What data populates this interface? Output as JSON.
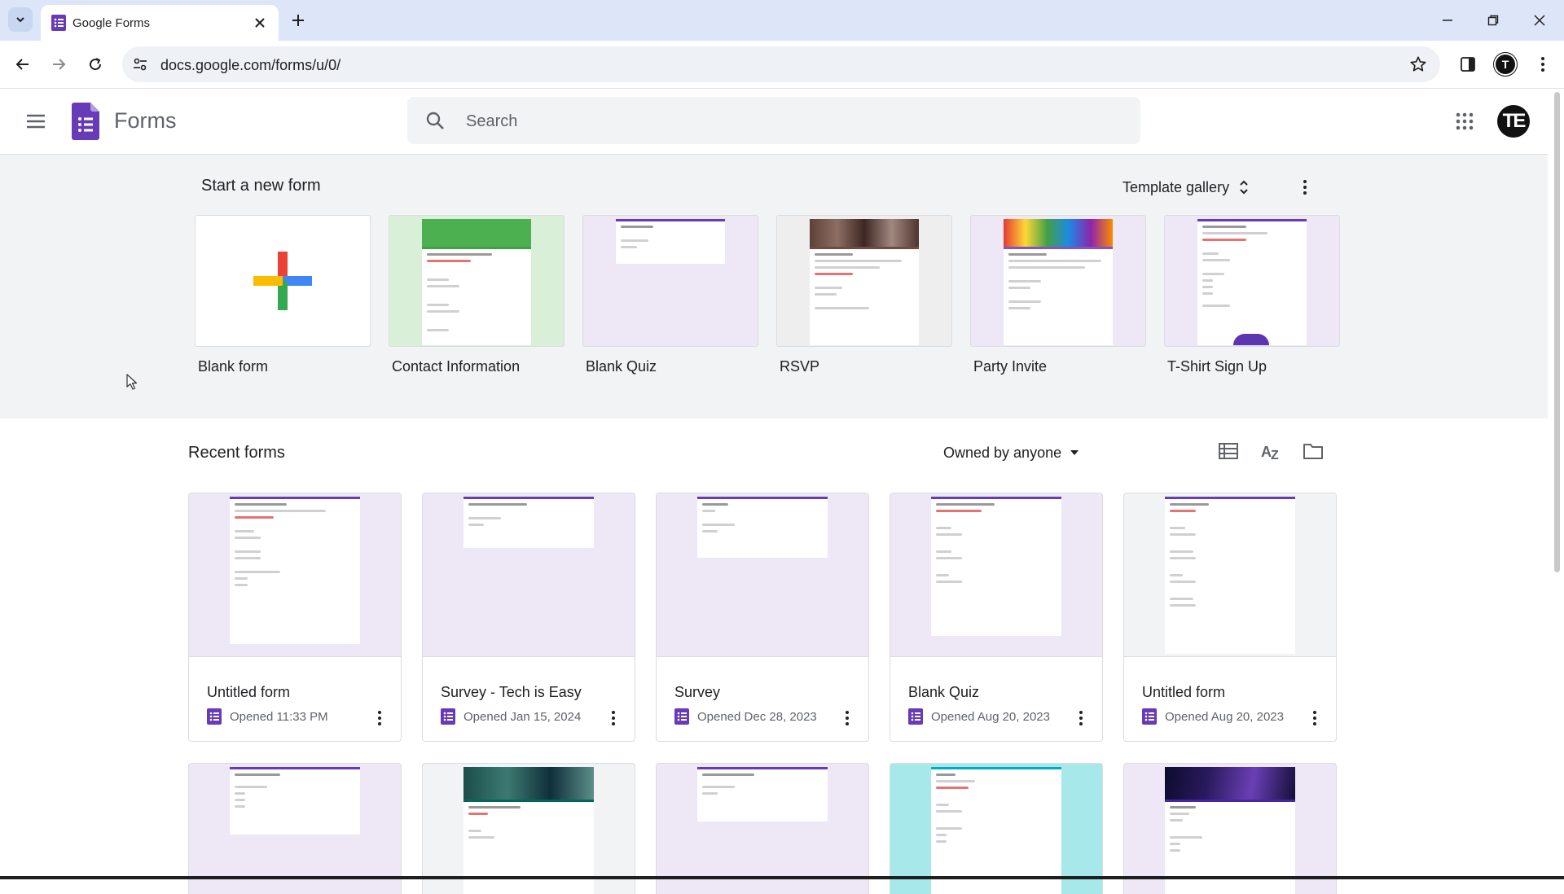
{
  "browser": {
    "tab_title": "Google Forms",
    "url": "docs.google.com/forms/u/0/",
    "profile_initial": "T"
  },
  "app": {
    "title": "Forms",
    "search_placeholder": "Search",
    "account_initials": "TE"
  },
  "start": {
    "heading": "Start a new form",
    "template_gallery_label": "Template gallery",
    "templates": [
      {
        "label": "Blank form"
      },
      {
        "label": "Contact Information"
      },
      {
        "label": "Blank Quiz"
      },
      {
        "label": "RSVP"
      },
      {
        "label": "Party Invite"
      },
      {
        "label": "T-Shirt Sign Up"
      }
    ]
  },
  "recent": {
    "heading": "Recent forms",
    "owner_filter": "Owned by anyone",
    "forms": [
      {
        "title": "Untitled form",
        "opened": "Opened 11:33 PM"
      },
      {
        "title": "Survey - Tech is Easy",
        "opened": "Opened Jan 15, 2024"
      },
      {
        "title": "Survey",
        "opened": "Opened Dec 28, 2023"
      },
      {
        "title": "Blank Quiz",
        "opened": "Opened Aug 20, 2023"
      },
      {
        "title": "Untitled form",
        "opened": "Opened Aug 20, 2023"
      }
    ]
  },
  "colors": {
    "forms_purple": "#673ab7",
    "tabbar_bg": "#dce6f8",
    "section_bg": "#f1f3f4"
  }
}
